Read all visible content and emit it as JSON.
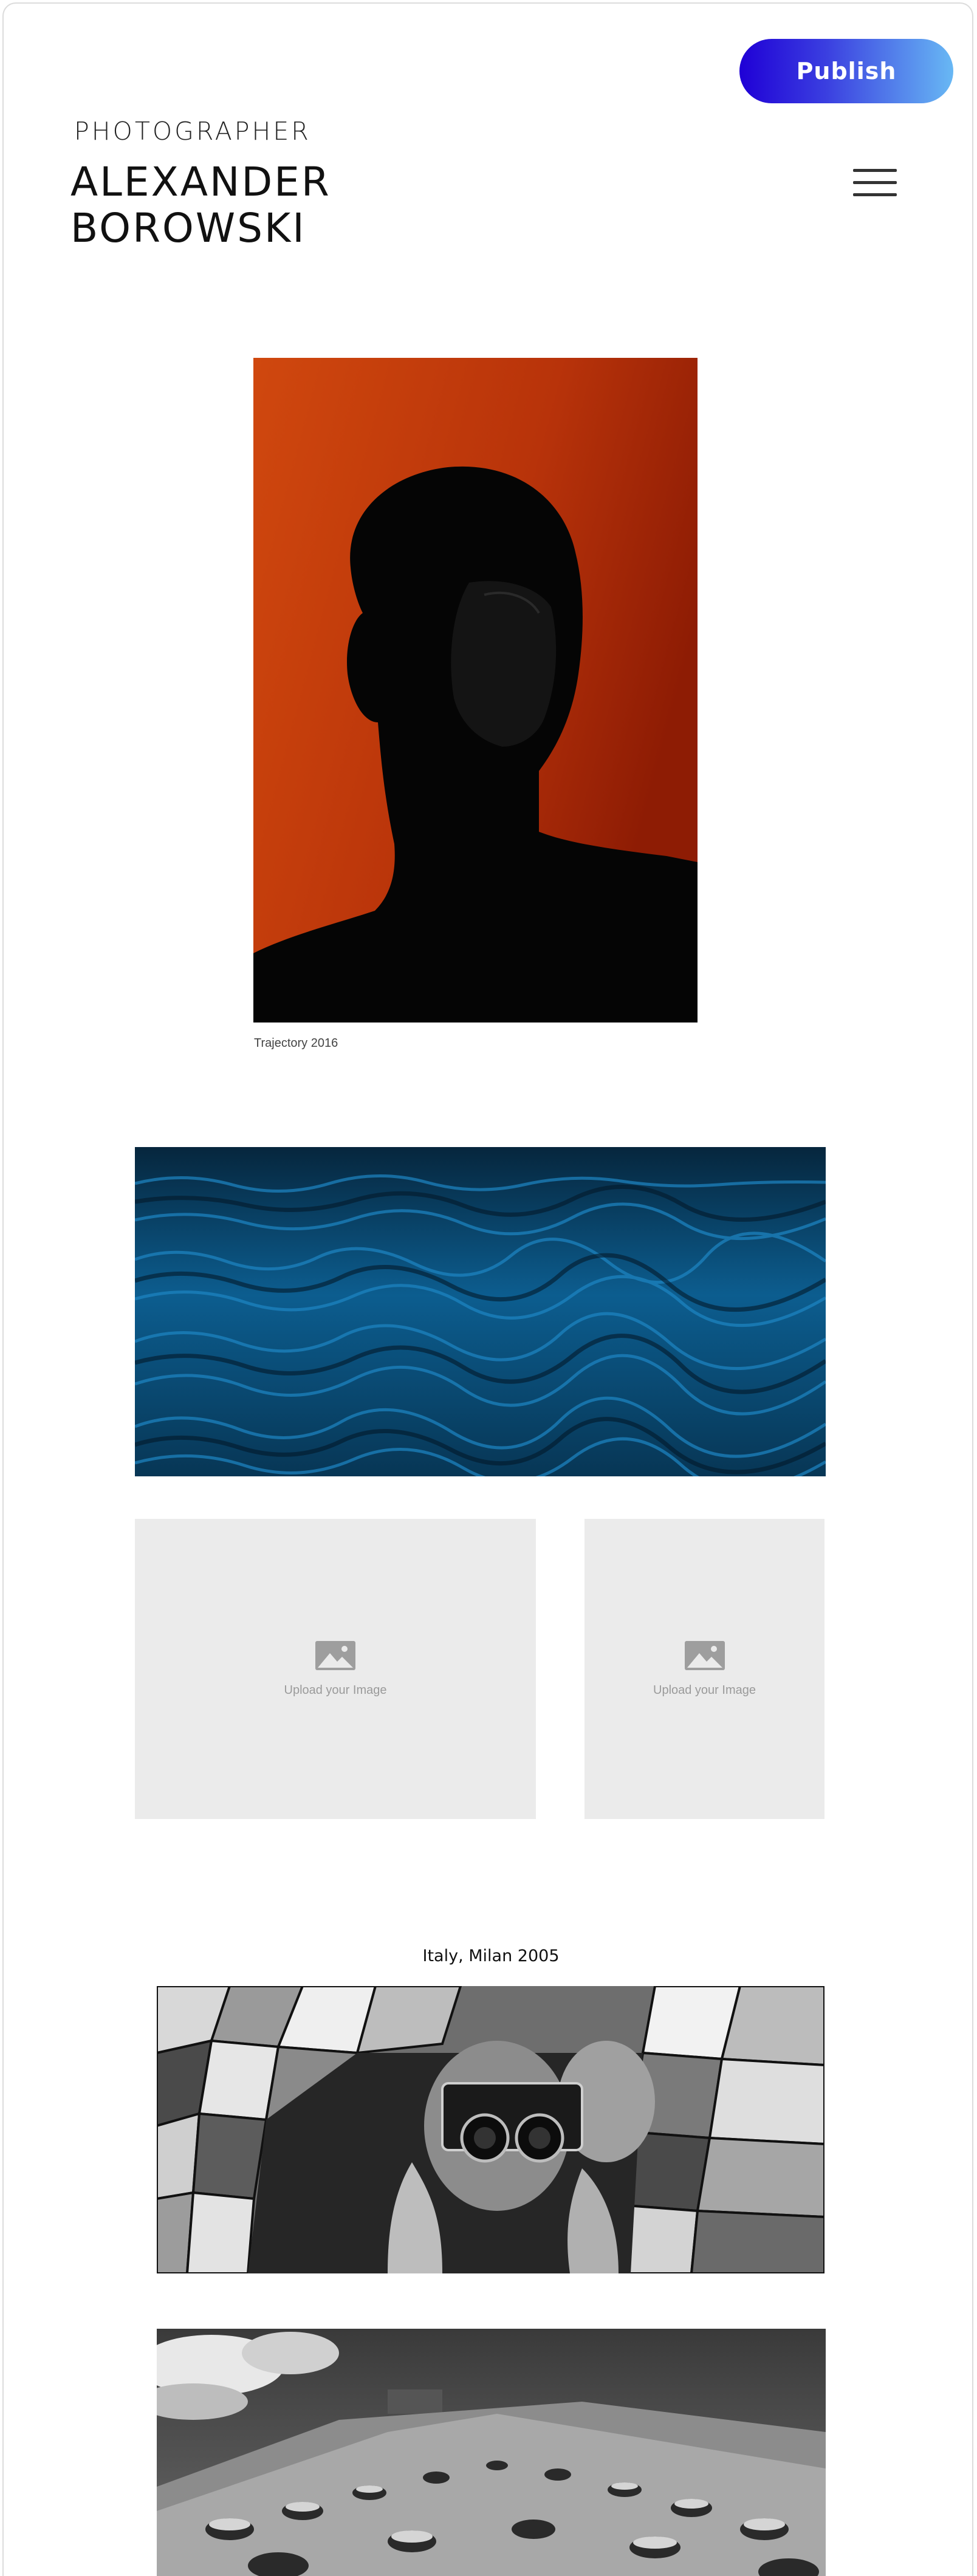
{
  "toolbar": {
    "publish_label": "Publish"
  },
  "header": {
    "role": "PHOTOGRAPHER",
    "name_line1": "ALEXANDER",
    "name_line2": "BOROWSKI",
    "menu_icon": "hamburger-menu-icon"
  },
  "gallery": {
    "portrait_caption": "Trajectory 2016",
    "upload_label_1": "Upload your Image",
    "upload_label_2": "Upload your Image",
    "upload_icon": "image-icon",
    "milan_caption": "Italy, Milan 2005"
  },
  "colors": {
    "publish_gradient_start": "#1f00d6",
    "publish_gradient_end": "#68b8f4",
    "portrait_background": "#c9420e",
    "water": "#0a4f7a",
    "placeholder": "#ebebeb"
  }
}
